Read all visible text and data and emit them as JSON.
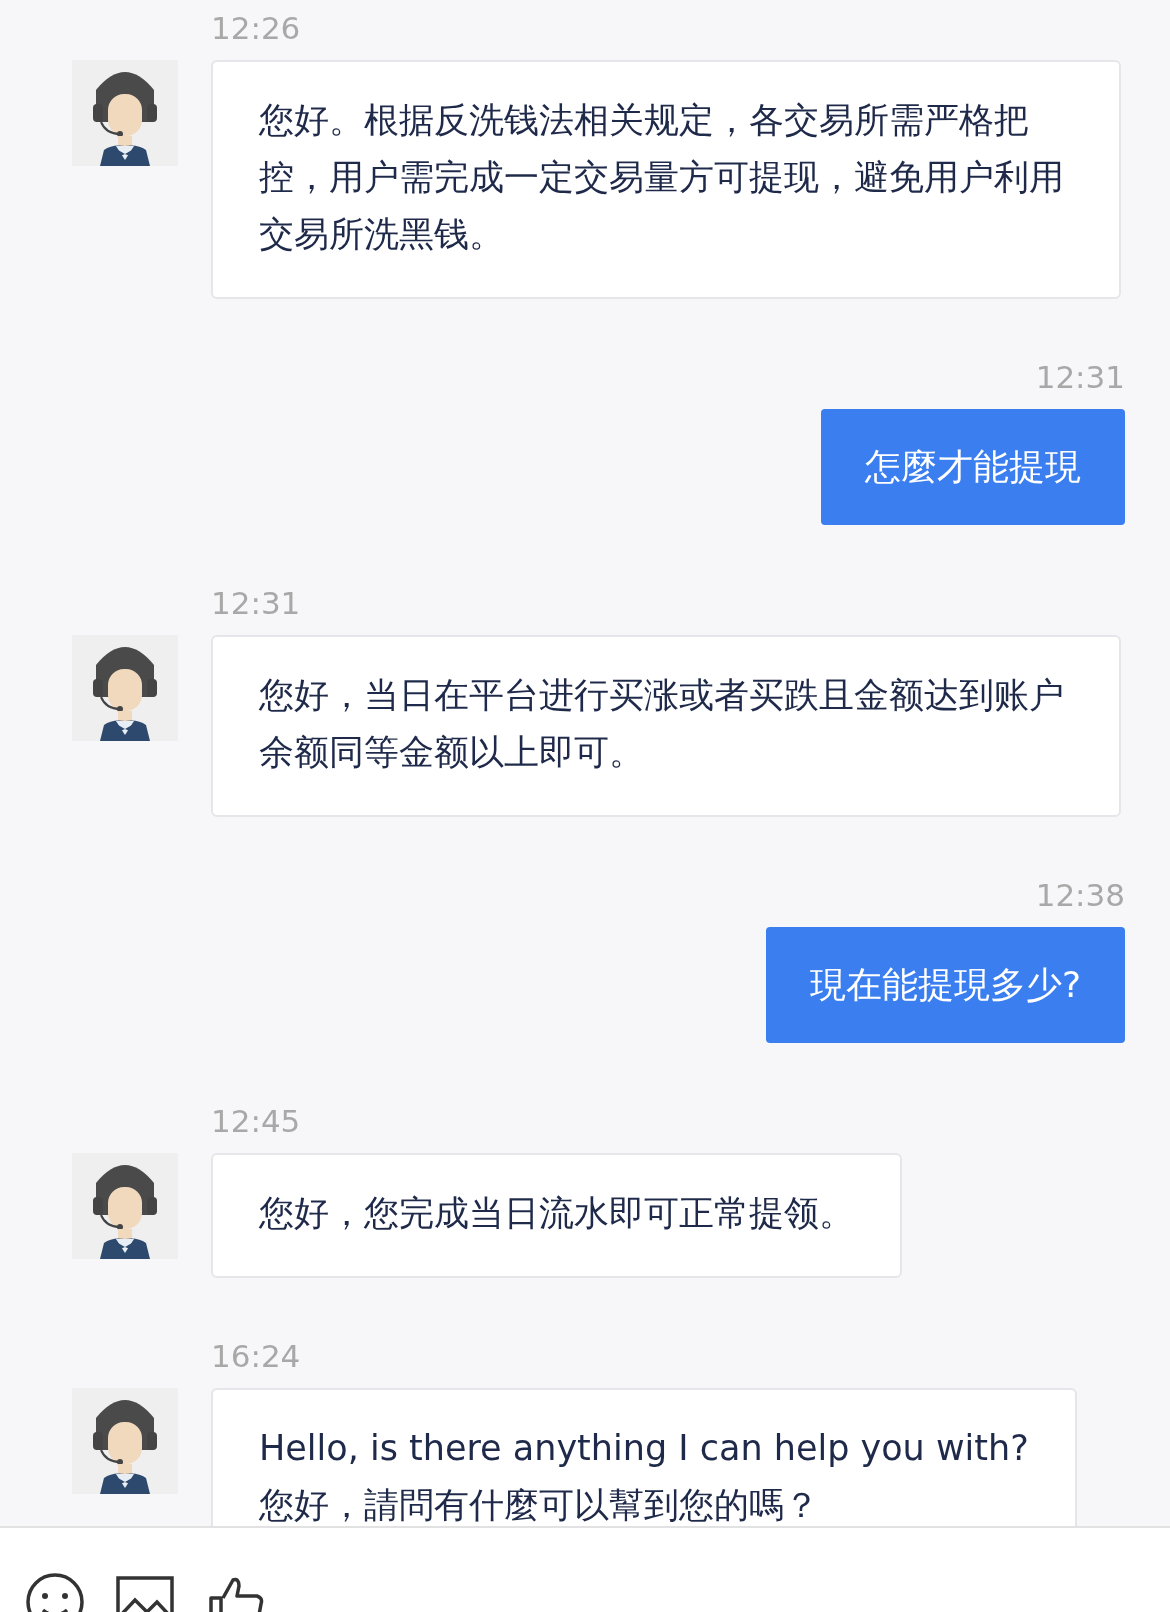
{
  "messages": [
    {
      "kind": "incoming",
      "time": "12:26",
      "paragraphs": [
        "您好。根据反洗钱法相关规定，各交易所需严格把控，用户需完成一定交易量方可提现，避免用户利用交易所洗黑钱。"
      ]
    },
    {
      "kind": "outgoing",
      "time": "12:31",
      "paragraphs": [
        "怎麼才能提現"
      ]
    },
    {
      "kind": "incoming",
      "time": "12:31",
      "paragraphs": [
        "您好，当日在平台进行买涨或者买跌且金额达到账户余额同等金额以上即可。"
      ]
    },
    {
      "kind": "outgoing",
      "time": "12:38",
      "paragraphs": [
        "現在能提現多少?"
      ]
    },
    {
      "kind": "incoming",
      "time": "12:45",
      "paragraphs": [
        "您好，您完成当日流水即可正常提领。"
      ]
    },
    {
      "kind": "incoming",
      "time": "16:24",
      "paragraphs": [
        "Hello, is there anything I can help you with?",
        "您好，請問有什麼可以幫到您的嗎？"
      ]
    }
  ],
  "toolbar": {
    "buttons": [
      {
        "kind": "emoji"
      },
      {
        "kind": "image"
      },
      {
        "kind": "like"
      }
    ]
  }
}
